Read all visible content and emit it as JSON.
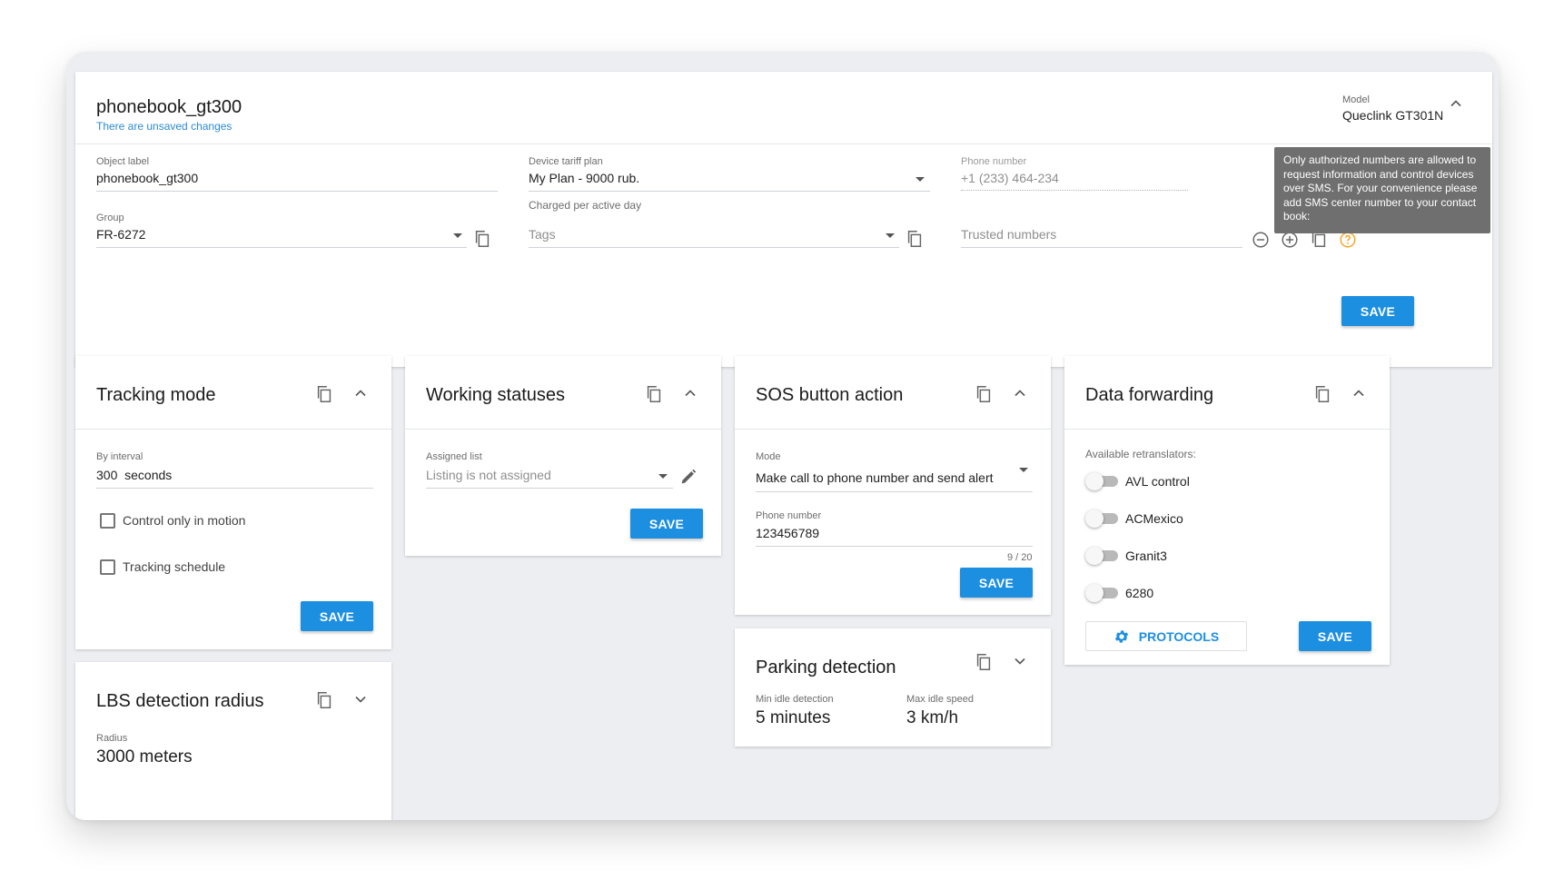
{
  "top": {
    "title": "phonebook_gt300",
    "unsaved": "There are unsaved changes",
    "model_label": "Model",
    "model_value": "Queclink GT301N",
    "object_label": "Object label",
    "object_value": "phonebook_gt300",
    "group_label": "Group",
    "group_value": "FR-6272",
    "tariff_label": "Device tariff plan",
    "tariff_plan_name": "My Plan - ",
    "tariff_plan_price": "9000 rub.",
    "tariff_hint": "Charged per active day",
    "tags_placeholder": "Tags",
    "phone_label": "Phone number",
    "phone_value": "+1 (233) 464-234",
    "trusted_placeholder": "Trusted numbers",
    "tooltip": "Only authorized numbers are allowed to request information and control devices over SMS. For your convenience please add SMS center number to your contact book:",
    "save": "SAVE"
  },
  "tracking": {
    "title": "Tracking mode",
    "interval_label": "By interval",
    "interval_value": "300",
    "interval_unit": "seconds",
    "opt_motion": "Control only in motion",
    "opt_schedule": "Tracking schedule",
    "save": "SAVE"
  },
  "lbs": {
    "title": "LBS detection radius",
    "radius_label": "Radius",
    "radius_value": "3000 meters"
  },
  "statuses": {
    "title": "Working statuses",
    "list_label": "Assigned list",
    "list_value": "Listing is not assigned",
    "save": "SAVE"
  },
  "sos": {
    "title": "SOS button action",
    "mode_label": "Mode",
    "mode_value": "Make call to phone number and send alert",
    "phone_label": "Phone number",
    "phone_value": "123456789",
    "counter": "9 / 20",
    "save": "SAVE"
  },
  "parking": {
    "title": "Parking detection",
    "idle_label": "Min idle detection",
    "idle_value": "5 minutes",
    "speed_label": "Max idle speed",
    "speed_value": "3 km/h"
  },
  "forwarding": {
    "title": "Data forwarding",
    "list_label": "Available retranslators:",
    "items": [
      {
        "label": "AVL control",
        "enabled": false
      },
      {
        "label": "ACMexico",
        "enabled": false
      },
      {
        "label": "Granit3",
        "enabled": false
      },
      {
        "label": "6280",
        "enabled": false
      }
    ],
    "protocols": "PROTOCOLS",
    "save": "SAVE"
  },
  "icons": [
    "copy-icon",
    "chevron-up-icon",
    "chevron-down-icon",
    "caret-down-icon",
    "pencil-icon",
    "minus-circle-icon",
    "plus-circle-icon",
    "help-circle-icon",
    "gear-icon"
  ],
  "colors": {
    "accent": "#1d8fe0",
    "link": "#2b8ad7",
    "help": "#f5a623",
    "tooltip": "#6f6f6f",
    "background": "#eceef1"
  }
}
